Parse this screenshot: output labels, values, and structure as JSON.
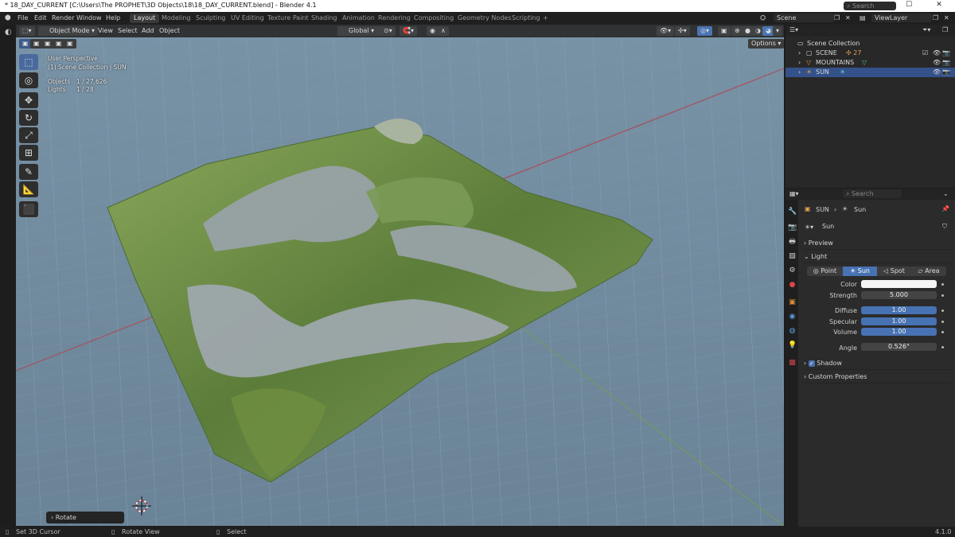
{
  "window": {
    "title": "* 18_DAY_CURRENT [C:\\Users\\The PROPHET\\3D Objects\\18\\18_DAY_CURRENT.blend] - Blender 4.1",
    "minimize": "—",
    "maximize": "☐",
    "close": "✕"
  },
  "menu": [
    "File",
    "Edit",
    "Render",
    "Window",
    "Help"
  ],
  "workspaces": [
    "Layout",
    "Modeling",
    "Sculpting",
    "UV Editing",
    "Texture Paint",
    "Shading",
    "Animation",
    "Rendering",
    "Compositing",
    "Geometry Nodes",
    "Scripting"
  ],
  "add_workspace": "+",
  "scene": {
    "name": "Scene",
    "view_layer": "ViewLayer"
  },
  "viewport_header": {
    "mode": "Object Mode",
    "menus": [
      "View",
      "Select",
      "Add",
      "Object"
    ],
    "transform_orientation": "Global",
    "options": "Options"
  },
  "viewport_overlay": {
    "perspective": "User Perspective",
    "collection": "(1) Scene Collection | SUN",
    "objects_label": "Objects",
    "objects_value": "1 / 27,626",
    "lights_label": "Lights",
    "lights_value": "1 / 28"
  },
  "tools": [
    "select",
    "cursor",
    "move",
    "rotate",
    "scale",
    "transform",
    "annotate",
    "measure",
    "add-cube"
  ],
  "outliner": {
    "search_placeholder": "Search",
    "root": "Scene Collection",
    "items": [
      {
        "name": "SCENE",
        "count": "27"
      },
      {
        "name": "MOUNTAINS",
        "count": ""
      },
      {
        "name": "SUN",
        "count": ""
      }
    ]
  },
  "properties": {
    "search_placeholder": "Search",
    "breadcrumb_object": "SUN",
    "breadcrumb_data": "Sun",
    "datablock": "Sun",
    "panels": {
      "preview": "Preview",
      "light": "Light",
      "shadow": "Shadow",
      "custom": "Custom Properties"
    },
    "light_types": [
      "Point",
      "Sun",
      "Spot",
      "Area"
    ],
    "active_type_index": 1,
    "fields": {
      "color_label": "Color",
      "strength_label": "Strength",
      "strength": "5.000",
      "diffuse_label": "Diffuse",
      "diffuse": "1.00",
      "specular_label": "Specular",
      "specular": "1.00",
      "volume_label": "Volume",
      "volume": "1.00",
      "angle_label": "Angle",
      "angle": "0.526°"
    },
    "shadow_enabled": true
  },
  "status": {
    "left": "Set 3D Cursor",
    "middle": "Rotate View",
    "right": "Select",
    "version": "4.1.0"
  },
  "operator_panel": "Rotate",
  "colors": {
    "accent": "#4772b3",
    "selection": "#34518a",
    "viewport_bg": "#6f8a9e"
  }
}
